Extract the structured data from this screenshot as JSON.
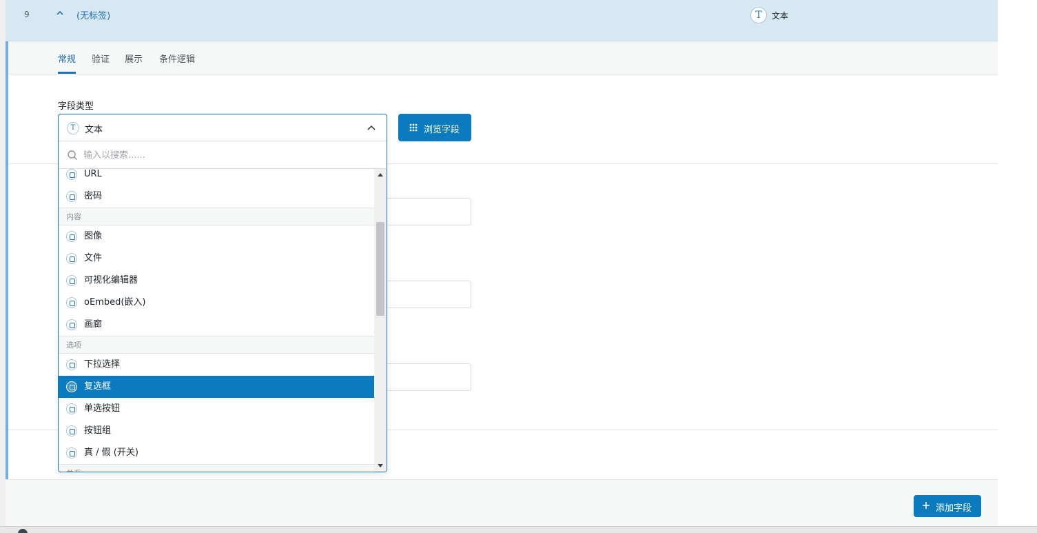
{
  "row": {
    "number": "9",
    "label": "(无标签)",
    "type_icon": "T",
    "type_label": "文本"
  },
  "tabs": [
    {
      "label": "常规",
      "active": true
    },
    {
      "label": "验证"
    },
    {
      "label": "展示"
    },
    {
      "label": "条件逻辑"
    }
  ],
  "field_type": {
    "label": "字段类型",
    "selected": "文本",
    "selected_icon": "T",
    "search_placeholder": "输入以搜索......",
    "browse_button": "浏览字段",
    "options": [
      {
        "kind": "option",
        "label": "URL",
        "icon": "globe-icon"
      },
      {
        "kind": "option",
        "label": "密码",
        "icon": "key-icon"
      },
      {
        "kind": "group",
        "label": "内容"
      },
      {
        "kind": "option",
        "label": "图像",
        "icon": "image-icon"
      },
      {
        "kind": "option",
        "label": "文件",
        "icon": "paperclip-icon"
      },
      {
        "kind": "option",
        "label": "可视化编辑器",
        "icon": "editor-icon"
      },
      {
        "kind": "option",
        "label": "oEmbed(嵌入)",
        "icon": "embed-icon"
      },
      {
        "kind": "option",
        "label": "画廊",
        "icon": "gallery-icon"
      },
      {
        "kind": "group",
        "label": "选项"
      },
      {
        "kind": "option",
        "label": "下拉选择",
        "icon": "select-icon"
      },
      {
        "kind": "option",
        "label": "复选框",
        "icon": "checkbox-icon",
        "selected": true
      },
      {
        "kind": "option",
        "label": "单选按钮",
        "icon": "radio-icon"
      },
      {
        "kind": "option",
        "label": "按钮组",
        "icon": "cursor-icon"
      },
      {
        "kind": "option",
        "label": "真 / 假 (开关)",
        "icon": "toggle-icon"
      },
      {
        "kind": "group",
        "label": "关系"
      }
    ]
  },
  "footer": {
    "add_button": "添加字段"
  },
  "colors": {
    "accent": "#0a7bbf",
    "header_bg": "#d8e8f3",
    "link": "#2271b1"
  }
}
